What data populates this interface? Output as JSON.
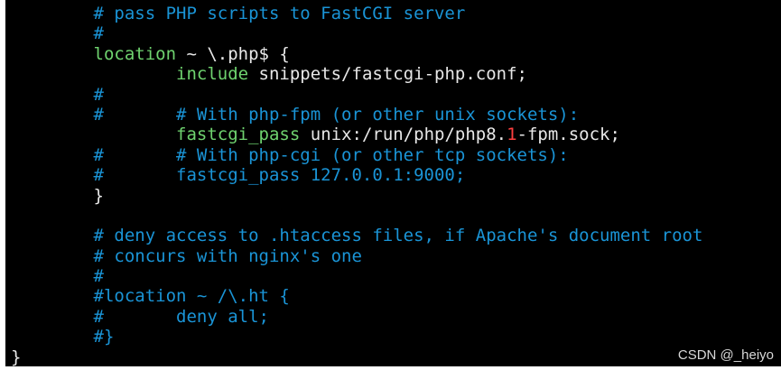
{
  "colors": {
    "background": "#000000",
    "comment": "#1a94d6",
    "keyword": "#6fd36f",
    "number": "#ff4040",
    "text": "#e8e8e8"
  },
  "code": {
    "lines": [
      [
        {
          "t": "comment",
          "s": "        # pass PHP scripts to FastCGI server"
        }
      ],
      [
        {
          "t": "comment",
          "s": "        #"
        }
      ],
      [
        {
          "t": "plain",
          "s": "        "
        },
        {
          "t": "keyword",
          "s": "location"
        },
        {
          "t": "plain",
          "s": " ~ \\.php$ {"
        }
      ],
      [
        {
          "t": "plain",
          "s": "                "
        },
        {
          "t": "keyword",
          "s": "include"
        },
        {
          "t": "plain",
          "s": " snippets/fastcgi-php.conf;"
        }
      ],
      [
        {
          "t": "comment",
          "s": "        #"
        }
      ],
      [
        {
          "t": "comment",
          "s": "        #       # With php-fpm (or other unix sockets):"
        }
      ],
      [
        {
          "t": "plain",
          "s": "                "
        },
        {
          "t": "keyword",
          "s": "fastcgi_pass"
        },
        {
          "t": "plain",
          "s": " unix:/run/php/php8."
        },
        {
          "t": "number",
          "s": "1"
        },
        {
          "t": "plain",
          "s": "-fpm.sock;"
        }
      ],
      [
        {
          "t": "comment",
          "s": "        #       # With php-cgi (or other tcp sockets):"
        }
      ],
      [
        {
          "t": "comment",
          "s": "        #       fastcgi_pass 127.0.0.1:9000;"
        }
      ],
      [
        {
          "t": "plain",
          "s": "        }"
        }
      ],
      [
        {
          "t": "plain",
          "s": ""
        }
      ],
      [
        {
          "t": "comment",
          "s": "        # deny access to .htaccess files, if Apache's document root"
        }
      ],
      [
        {
          "t": "comment",
          "s": "        # concurs with nginx's one"
        }
      ],
      [
        {
          "t": "comment",
          "s": "        #"
        }
      ],
      [
        {
          "t": "comment",
          "s": "        #location ~ /\\.ht {"
        }
      ],
      [
        {
          "t": "comment",
          "s": "        #       deny all;"
        }
      ],
      [
        {
          "t": "comment",
          "s": "        #}"
        }
      ],
      [
        {
          "t": "plain",
          "s": "}"
        }
      ]
    ]
  },
  "watermark": "CSDN @_heiyo"
}
